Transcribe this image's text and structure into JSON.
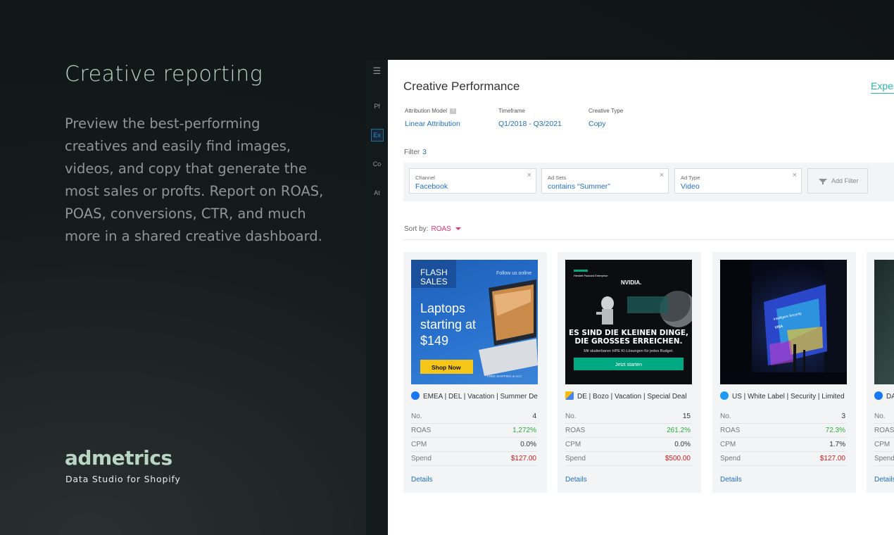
{
  "hero": {
    "title": "Creative reporting",
    "body": "Preview the best-performing creatives and easily find images, videos, and copy that generate the most sales or profts. Report on ROAS, POAS, conversions, CTR, and much more in a shared creative dashboard."
  },
  "brand": {
    "name": "admetrics",
    "tagline": "Data Studio for Shopify"
  },
  "rail": {
    "items": [
      "Pf",
      "Ex",
      "Co",
      "At"
    ],
    "active": "Ex"
  },
  "app": {
    "title": "Creative Performance",
    "header_link": "Experi",
    "meta": [
      {
        "label": "Attribution Model",
        "value": "Linear Attribution",
        "info": "?"
      },
      {
        "label": "Timeframe",
        "value": "Q1/2018 - Q3/2021"
      },
      {
        "label": "Creative Type",
        "value": "Copy"
      }
    ],
    "filter": {
      "label": "Filter",
      "count": "3"
    },
    "filters": [
      {
        "label": "Channel",
        "value": "Facebook"
      },
      {
        "label": "Ad Sets",
        "value": "contains “Summer”"
      },
      {
        "label": "Ad Type",
        "value": "Video"
      }
    ],
    "add_filter": "Add Filter",
    "sort": {
      "label": "Sort by:",
      "value": "ROAS"
    },
    "cards": [
      {
        "title": "EMEA | DEL | Vacation | Summer De",
        "platform": "facebook",
        "stats": [
          {
            "k": "No.",
            "v": "4"
          },
          {
            "k": "ROAS",
            "v": "1,272%"
          },
          {
            "k": "CPM",
            "v": "0.0%"
          },
          {
            "k": "Spend",
            "v": "$127.00"
          }
        ],
        "details": "Details",
        "ad": {
          "tag1": "FLASH",
          "tag2": "SALES",
          "follow": "Follow us online",
          "l1": "Laptops",
          "l2": "starting at",
          "l3": "$149",
          "cta": "Shop Now",
          "footer": "FREE SHIPPING & ACC"
        }
      },
      {
        "title": "DE | Bozo | Vacation | Special Deal",
        "platform": "google-ads",
        "stats": [
          {
            "k": "No.",
            "v": "15"
          },
          {
            "k": "ROAS",
            "v": "261.2%"
          },
          {
            "k": "CPM",
            "v": "0.0%"
          },
          {
            "k": "Spend",
            "v": "$500.00"
          }
        ],
        "details": "Details",
        "ad": {
          "brand1": "Hewlett Packard Enterprise",
          "brand2": "NVIDIA.",
          "h1": "ES SIND DIE KLEINEN DINGE,",
          "h2": "DIE GROSSES ERREICHEN.",
          "sub": "Mit skalierbaren HPE KI-Lösungen für jedes Budget.",
          "cta": "Jetzt starten"
        }
      },
      {
        "title": "US | White Label | Security | Limited",
        "platform": "twitter",
        "stats": [
          {
            "k": "No.",
            "v": "3"
          },
          {
            "k": "ROAS",
            "v": "72.3%"
          },
          {
            "k": "CPM",
            "v": "1.7%"
          },
          {
            "k": "Spend",
            "v": "$127.00"
          }
        ],
        "details": "Details",
        "ad": {
          "caption": "Intelligent Security",
          "brand": "VISA"
        }
      },
      {
        "title": "DA",
        "platform": "facebook",
        "stats": [
          {
            "k": "No.",
            "v": ""
          },
          {
            "k": "ROAS",
            "v": ""
          },
          {
            "k": "CPM",
            "v": ""
          },
          {
            "k": "Spend",
            "v": ""
          }
        ],
        "details": "Details"
      }
    ]
  },
  "colors": {
    "accent_blue": "#1f6fbf",
    "positive": "#2cab3c",
    "negative": "#d21a1a",
    "sort_pink": "#e6326e",
    "hero_green": "#b9d6c4"
  }
}
